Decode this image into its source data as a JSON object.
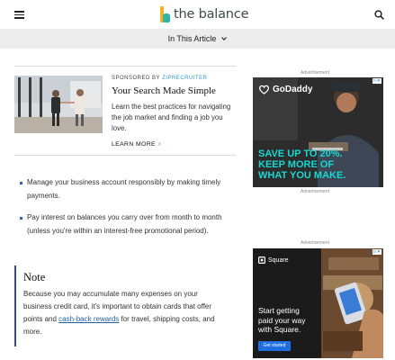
{
  "header": {
    "logo_text": "the balance",
    "brand_colors": {
      "yellow": "#f4b223",
      "teal": "#2fb5a8"
    }
  },
  "article_bar": {
    "label": "In This Article"
  },
  "sponsor": {
    "sponsored_prefix": "SPONSORED BY",
    "sponsor_name": "ZIPRECRUITER",
    "title": "Your Search Made Simple",
    "description": "Learn the best practices for navigating the job market and finding a job you love.",
    "cta": "LEARN MORE"
  },
  "bullets": [
    "Manage your business account responsibly by making timely payments.",
    "Pay interest on balances you carry over from month to month (unless you're within an interest-free promotional period)."
  ],
  "note": {
    "title": "Note",
    "body_before": "Because you may accumulate many expenses on your business credit card, it's important to obtain cards that offer points and ",
    "link": "cash-back rewards",
    "body_after": " for travel, shipping costs, and more."
  },
  "ads": {
    "label": "Advertisement",
    "godaddy": {
      "brand": "GoDaddy",
      "line1": "SAVE UP TO 20%.",
      "line2": "KEEP MORE OF",
      "line3": "WHAT YOU MAKE.",
      "accent": "#18d8d2"
    },
    "square": {
      "brand": "Square",
      "headline_1": "Start getting",
      "headline_2": "paid your way",
      "headline_3": "with Square.",
      "cta": "Get started",
      "cta_color": "#1f6fe0"
    }
  }
}
